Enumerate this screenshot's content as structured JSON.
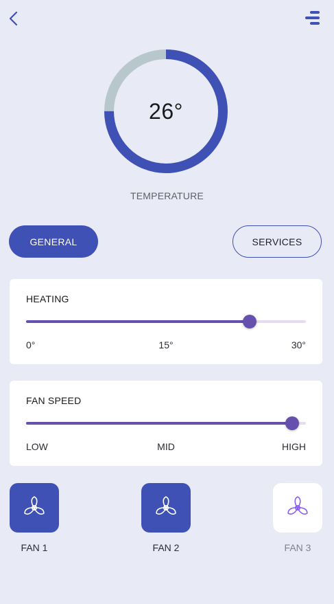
{
  "header": {
    "back_icon": "chevron-left-icon",
    "menu_icon": "menu-lines-icon",
    "accent_color": "#3f51b5"
  },
  "gauge": {
    "value": "26°",
    "label": "TEMPERATURE",
    "fill_fraction": 0.75,
    "fill_color": "#3f51b5",
    "track_color": "#b8c7cc"
  },
  "tabs": [
    {
      "label": "GENERAL",
      "active": true
    },
    {
      "label": "SERVICES",
      "active": false
    }
  ],
  "heating": {
    "title": "HEATING",
    "min_label": "0°",
    "mid_label": "15°",
    "max_label": "30°",
    "level": 0.8,
    "color": "#6650ad"
  },
  "fan_speed": {
    "title": "FAN SPEED",
    "min_label": "LOW",
    "mid_label": "MID",
    "max_label": "HIGH",
    "level": 0.95,
    "color": "#6650ad"
  },
  "fans": [
    {
      "label": "FAN 1",
      "active": true,
      "icon": "fan-icon"
    },
    {
      "label": "FAN 2",
      "active": true,
      "icon": "fan-icon"
    },
    {
      "label": "FAN 3",
      "active": false,
      "icon": "fan-icon"
    }
  ]
}
